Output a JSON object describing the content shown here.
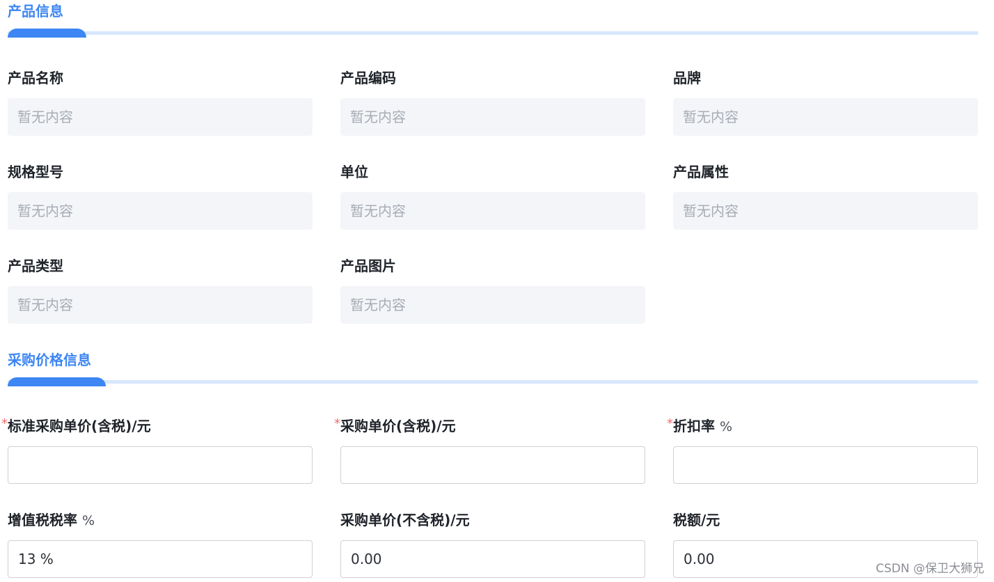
{
  "product_info": {
    "title": "产品信息",
    "fields": [
      {
        "label": "产品名称",
        "value": "暂无内容"
      },
      {
        "label": "产品编码",
        "value": "暂无内容"
      },
      {
        "label": "品牌",
        "value": "暂无内容"
      },
      {
        "label": "规格型号",
        "value": "暂无内容"
      },
      {
        "label": "单位",
        "value": "暂无内容"
      },
      {
        "label": "产品属性",
        "value": "暂无内容"
      },
      {
        "label": "产品类型",
        "value": "暂无内容"
      },
      {
        "label": "产品图片",
        "value": "暂无内容"
      }
    ]
  },
  "purchase_price": {
    "title": "采购价格信息",
    "required_mark": "*",
    "fields": [
      {
        "label": "标准采购单价(含税)/元",
        "value": ""
      },
      {
        "label": "采购单价(含税)/元",
        "value": ""
      },
      {
        "label": "折扣率",
        "unit": "%",
        "value": ""
      },
      {
        "label": "增值税税率",
        "unit": "%",
        "value": "13 %"
      },
      {
        "label": "采购单价(不含税)/元",
        "value": "0.00"
      },
      {
        "label": "税额/元",
        "value": "0.00"
      }
    ]
  },
  "watermark": "CSDN @保卫大狮兄",
  "colors": {
    "accent": "#3d86f3",
    "accent_light": "#d7e7fc",
    "required": "#f56c6c",
    "readonly_bg": "#f3f5f8"
  }
}
